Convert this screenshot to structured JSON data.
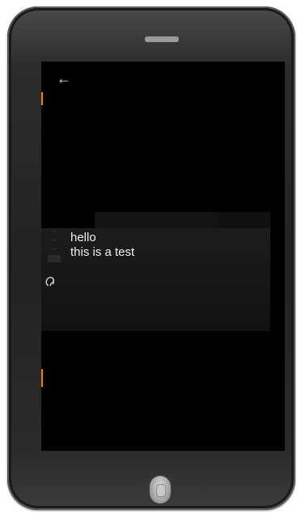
{
  "device": {
    "nav_icon": "arrow-left-icon",
    "earpiece": "speaker-slot",
    "home_button": "home-button"
  },
  "screen": {
    "left_labels": [
      "...",
      "...",
      "...",
      "..."
    ],
    "message_lines": [
      "hello",
      "this is a test"
    ],
    "side_labels": [
      "",
      "",
      ""
    ],
    "colors": {
      "background": "#000000",
      "panel": "#161616",
      "text": "#f2f2f2",
      "edge_accent": "#ff7a00"
    }
  }
}
